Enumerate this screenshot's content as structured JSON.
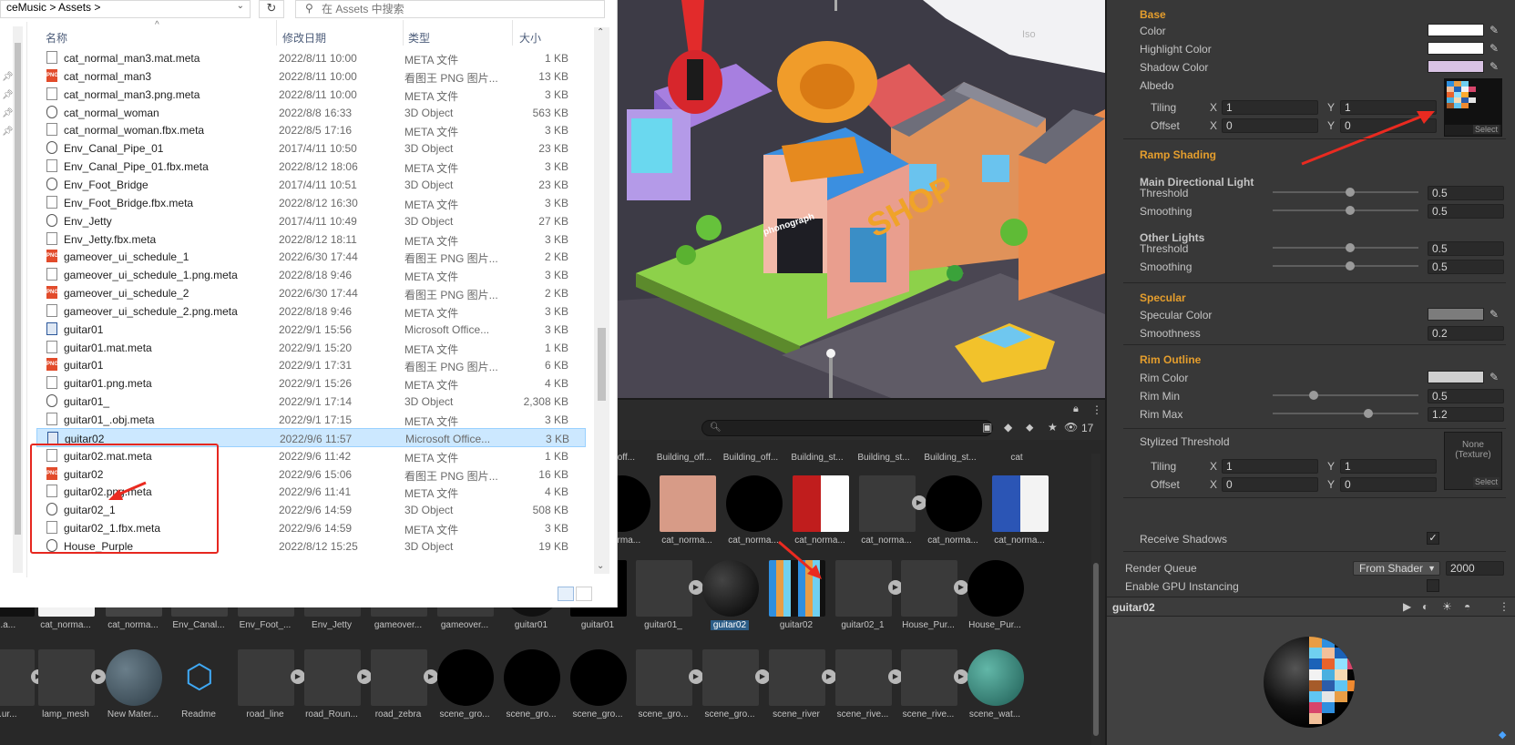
{
  "explorer": {
    "address": "ceMusic  >  Assets  >",
    "search_placeholder": "在 Assets 中搜索",
    "columns": {
      "name": "名称",
      "date": "修改日期",
      "type": "类型",
      "size": "大小"
    },
    "files": [
      {
        "name": "cat_normal_man3.mat.meta",
        "date": "2022/8/11 10:00",
        "type": "META 文件",
        "size": "1 KB",
        "icon": "file"
      },
      {
        "name": "cat_normal_man3",
        "date": "2022/8/11 10:00",
        "type": "看图王 PNG 图片...",
        "size": "13 KB",
        "icon": "png"
      },
      {
        "name": "cat_normal_man3.png.meta",
        "date": "2022/8/11 10:00",
        "type": "META 文件",
        "size": "3 KB",
        "icon": "file"
      },
      {
        "name": "cat_normal_woman",
        "date": "2022/8/8 16:33",
        "type": "3D Object",
        "size": "563 KB",
        "icon": "obj"
      },
      {
        "name": "cat_normal_woman.fbx.meta",
        "date": "2022/8/5 17:16",
        "type": "META 文件",
        "size": "3 KB",
        "icon": "file"
      },
      {
        "name": "Env_Canal_Pipe_01",
        "date": "2017/4/11 10:50",
        "type": "3D Object",
        "size": "23 KB",
        "icon": "obj"
      },
      {
        "name": "Env_Canal_Pipe_01.fbx.meta",
        "date": "2022/8/12 18:06",
        "type": "META 文件",
        "size": "3 KB",
        "icon": "file"
      },
      {
        "name": "Env_Foot_Bridge",
        "date": "2017/4/11 10:51",
        "type": "3D Object",
        "size": "23 KB",
        "icon": "obj"
      },
      {
        "name": "Env_Foot_Bridge.fbx.meta",
        "date": "2022/8/12 16:30",
        "type": "META 文件",
        "size": "3 KB",
        "icon": "file"
      },
      {
        "name": "Env_Jetty",
        "date": "2017/4/11 10:49",
        "type": "3D Object",
        "size": "27 KB",
        "icon": "obj"
      },
      {
        "name": "Env_Jetty.fbx.meta",
        "date": "2022/8/12 18:11",
        "type": "META 文件",
        "size": "3 KB",
        "icon": "file"
      },
      {
        "name": "gameover_ui_schedule_1",
        "date": "2022/6/30 17:44",
        "type": "看图王 PNG 图片...",
        "size": "2 KB",
        "icon": "png"
      },
      {
        "name": "gameover_ui_schedule_1.png.meta",
        "date": "2022/8/18 9:46",
        "type": "META 文件",
        "size": "3 KB",
        "icon": "file"
      },
      {
        "name": "gameover_ui_schedule_2",
        "date": "2022/6/30 17:44",
        "type": "看图王 PNG 图片...",
        "size": "2 KB",
        "icon": "png"
      },
      {
        "name": "gameover_ui_schedule_2.png.meta",
        "date": "2022/8/18 9:46",
        "type": "META 文件",
        "size": "3 KB",
        "icon": "file"
      },
      {
        "name": "guitar01",
        "date": "2022/9/1 15:56",
        "type": "Microsoft Office...",
        "size": "3 KB",
        "icon": "office"
      },
      {
        "name": "guitar01.mat.meta",
        "date": "2022/9/1 15:20",
        "type": "META 文件",
        "size": "1 KB",
        "icon": "file"
      },
      {
        "name": "guitar01",
        "date": "2022/9/1 17:31",
        "type": "看图王 PNG 图片...",
        "size": "6 KB",
        "icon": "png"
      },
      {
        "name": "guitar01.png.meta",
        "date": "2022/9/1 15:26",
        "type": "META 文件",
        "size": "4 KB",
        "icon": "file"
      },
      {
        "name": "guitar01_",
        "date": "2022/9/1 17:14",
        "type": "3D Object",
        "size": "2,308 KB",
        "icon": "obj"
      },
      {
        "name": "guitar01_.obj.meta",
        "date": "2022/9/1 17:15",
        "type": "META 文件",
        "size": "3 KB",
        "icon": "file"
      },
      {
        "name": "guitar02",
        "date": "2022/9/6 11:57",
        "type": "Microsoft Office...",
        "size": "3 KB",
        "icon": "office",
        "selected": true
      },
      {
        "name": "guitar02.mat.meta",
        "date": "2022/9/6 11:42",
        "type": "META 文件",
        "size": "1 KB",
        "icon": "file"
      },
      {
        "name": "guitar02",
        "date": "2022/9/6 15:06",
        "type": "看图王 PNG 图片...",
        "size": "16 KB",
        "icon": "png"
      },
      {
        "name": "guitar02.png.meta",
        "date": "2022/9/6 11:41",
        "type": "META 文件",
        "size": "4 KB",
        "icon": "file"
      },
      {
        "name": "guitar02_1",
        "date": "2022/9/6 14:59",
        "type": "3D Object",
        "size": "508 KB",
        "icon": "obj"
      },
      {
        "name": "guitar02_1.fbx.meta",
        "date": "2022/9/6 14:59",
        "type": "META 文件",
        "size": "3 KB",
        "icon": "file"
      },
      {
        "name": "House_Purple",
        "date": "2022/8/12 15:25",
        "type": "3D Object",
        "size": "19 KB",
        "icon": "obj"
      }
    ]
  },
  "scene": {
    "view_label": "Iso",
    "shop_sign": "SHOP",
    "phonograph_sign": "phonograph"
  },
  "project": {
    "hidden_count": "17",
    "row_top_labels": [
      "ng_off...",
      "Building_off...",
      "Building_off...",
      "Building_st...",
      "Building_st...",
      "Building_st...",
      "cat"
    ],
    "row1": [
      "_norma...",
      "cat_norma...",
      "cat_norma...",
      "cat_norma...",
      "cat_norma...",
      "cat_norma...",
      "cat_norma..."
    ],
    "row2": [
      "...a...",
      "cat_norma...",
      "cat_norma...",
      "Env_Canal...",
      "Env_Foot_...",
      "Env_Jetty",
      "gameover...",
      "gameover...",
      "guitar01",
      "guitar01",
      "guitar01_",
      "guitar02",
      "guitar02",
      "guitar02_1",
      "House_Pur...",
      "House_Pur..."
    ],
    "row3": [
      "...ur...",
      "lamp_mesh",
      "New Mater...",
      "Readme",
      "road_line",
      "road_Roun...",
      "road_zebra",
      "scene_gro...",
      "scene_gro...",
      "scene_gro...",
      "scene_gro...",
      "scene_gro...",
      "scene_river",
      "scene_rive...",
      "scene_rive...",
      "scene_wat..."
    ]
  },
  "inspector": {
    "base": "Base",
    "color": "Color",
    "highlight_color": "Highlight Color",
    "shadow_color": "Shadow Color",
    "albedo": "Albedo",
    "tiling": "Tiling",
    "offset": "Offset",
    "x": "X",
    "y": "Y",
    "albedo_tiling_x": "1",
    "albedo_tiling_y": "1",
    "albedo_offset_x": "0",
    "albedo_offset_y": "0",
    "select": "Select",
    "ramp_shading": "Ramp Shading",
    "main_light": "Main Directional Light",
    "threshold": "Threshold",
    "smoothing": "Smoothing",
    "main_threshold": "0.5",
    "main_smoothing": "0.5",
    "other_lights": "Other Lights",
    "other_threshold": "0.5",
    "other_smoothing": "0.5",
    "specular": "Specular",
    "specular_color": "Specular Color",
    "smoothness": "Smoothness",
    "smoothness_value": "0.2",
    "rim_outline": "Rim Outline",
    "rim_color": "Rim Color",
    "rim_min": "Rim Min",
    "rim_min_value": "0.5",
    "rim_max": "Rim Max",
    "rim_max_value": "1.2",
    "stylized_threshold": "Stylized Threshold",
    "none_texture": "None (Texture)",
    "st_tiling_x": "1",
    "st_tiling_y": "1",
    "st_offset_x": "0",
    "st_offset_y": "0",
    "receive_shadows": "Receive Shadows",
    "render_queue": "Render Queue",
    "render_queue_mode": "From Shader",
    "render_queue_value": "2000",
    "gpu_instancing": "Enable GPU Instancing",
    "preview_title": "guitar02",
    "colors": {
      "color": "#ffffff",
      "highlight": "#ffffff",
      "shadow": "#d9c3e4",
      "specular": "#7c7c7c",
      "rim": "#cfcfcf",
      "accent": "#e59e2d",
      "selection": "#2c5d87"
    }
  }
}
